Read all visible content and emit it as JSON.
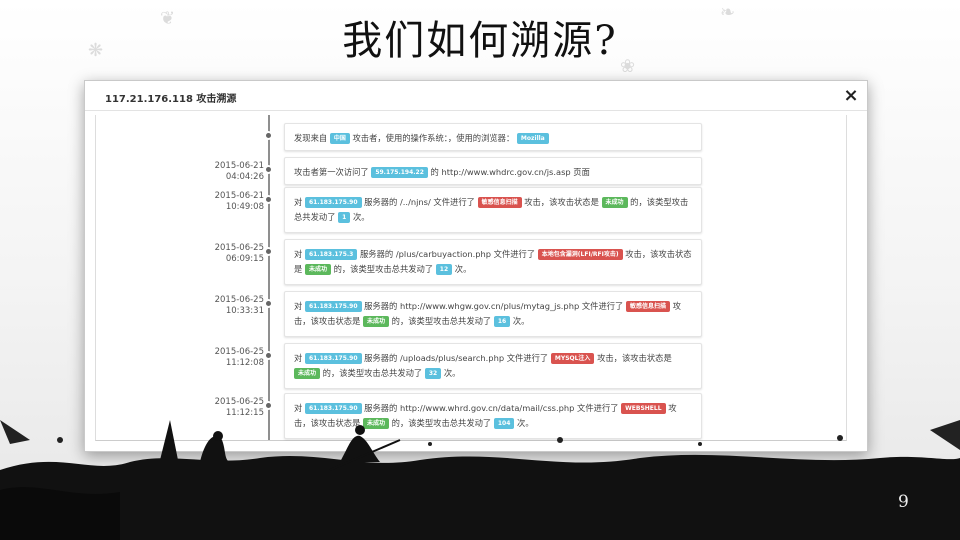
{
  "slide": {
    "title": "我们如何溯源?",
    "page_number": "9"
  },
  "modal": {
    "title": "117.21.176.118 攻击溯源",
    "close_label": "×"
  },
  "timeline": [
    {
      "time_date": "",
      "time_clock": "",
      "parts": [
        {
          "t": "text",
          "v": "发现来自 "
        },
        {
          "t": "badge",
          "c": "blue",
          "v": "中国"
        },
        {
          "t": "text",
          "v": " 攻击者，使用的操作系统：，使用的浏览器： "
        },
        {
          "t": "badge",
          "c": "blue",
          "v": "Mozilla"
        }
      ]
    },
    {
      "time_date": "2015-06-21",
      "time_clock": "04:04:26",
      "parts": [
        {
          "t": "text",
          "v": "攻击者第一次访问了 "
        },
        {
          "t": "badge",
          "c": "blue",
          "v": "59.175.194.22"
        },
        {
          "t": "text",
          "v": " 的 http://www.whdrc.gov.cn/js.asp 页面"
        }
      ]
    },
    {
      "time_date": "2015-06-21",
      "time_clock": "10:49:08",
      "parts": [
        {
          "t": "text",
          "v": "对 "
        },
        {
          "t": "badge",
          "c": "blue",
          "v": "61.183.175.90"
        },
        {
          "t": "text",
          "v": " 服务器的 /../njns/ 文件进行了 "
        },
        {
          "t": "badge",
          "c": "red",
          "v": "敏感信息扫描"
        },
        {
          "t": "text",
          "v": " 攻击，该攻击状态是 "
        },
        {
          "t": "badge",
          "c": "green",
          "v": "未成功"
        },
        {
          "t": "text",
          "v": " 的，该类型攻击总共发动了 "
        },
        {
          "t": "badge",
          "c": "blue",
          "v": "1"
        },
        {
          "t": "text",
          "v": " 次。"
        }
      ]
    },
    {
      "time_date": "2015-06-25",
      "time_clock": "06:09:15",
      "parts": [
        {
          "t": "text",
          "v": "对 "
        },
        {
          "t": "badge",
          "c": "blue",
          "v": "61.183.175.3"
        },
        {
          "t": "text",
          "v": " 服务器的 /plus/carbuyaction.php 文件进行了 "
        },
        {
          "t": "badge",
          "c": "red",
          "v": "本地包含漏洞(LFI/RFI攻击)"
        },
        {
          "t": "text",
          "v": " 攻击，该攻击状态是 "
        },
        {
          "t": "badge",
          "c": "green",
          "v": "未成功"
        },
        {
          "t": "text",
          "v": " 的，该类型攻击总共发动了 "
        },
        {
          "t": "badge",
          "c": "blue",
          "v": "12"
        },
        {
          "t": "text",
          "v": " 次。"
        }
      ]
    },
    {
      "time_date": "2015-06-25",
      "time_clock": "10:33:31",
      "parts": [
        {
          "t": "text",
          "v": "对 "
        },
        {
          "t": "badge",
          "c": "blue",
          "v": "61.183.175.90"
        },
        {
          "t": "text",
          "v": " 服务器的 http://www.whgw.gov.cn/plus/mytag_js.php 文件进行了 "
        },
        {
          "t": "badge",
          "c": "red",
          "v": "敏感信息扫描"
        },
        {
          "t": "text",
          "v": " 攻击，该攻击状态是 "
        },
        {
          "t": "badge",
          "c": "green",
          "v": "未成功"
        },
        {
          "t": "text",
          "v": " 的，该类型攻击总共发动了 "
        },
        {
          "t": "badge",
          "c": "blue",
          "v": "16"
        },
        {
          "t": "text",
          "v": " 次。"
        }
      ]
    },
    {
      "time_date": "2015-06-25",
      "time_clock": "11:12:08",
      "parts": [
        {
          "t": "text",
          "v": "对 "
        },
        {
          "t": "badge",
          "c": "blue",
          "v": "61.183.175.90"
        },
        {
          "t": "text",
          "v": " 服务器的 /uploads/plus/search.php 文件进行了 "
        },
        {
          "t": "badge",
          "c": "red",
          "v": "MYSQL注入"
        },
        {
          "t": "text",
          "v": " 攻击，该攻击状态是 "
        },
        {
          "t": "badge",
          "c": "green",
          "v": "未成功"
        },
        {
          "t": "text",
          "v": " 的，该类型攻击总共发动了 "
        },
        {
          "t": "badge",
          "c": "blue",
          "v": "32"
        },
        {
          "t": "text",
          "v": " 次。"
        }
      ]
    },
    {
      "time_date": "2015-06-25",
      "time_clock": "11:12:15",
      "parts": [
        {
          "t": "text",
          "v": "对 "
        },
        {
          "t": "badge",
          "c": "blue",
          "v": "61.183.175.90"
        },
        {
          "t": "text",
          "v": " 服务器的 http://www.whrd.gov.cn/data/mail/css.php 文件进行了 "
        },
        {
          "t": "badge",
          "c": "red",
          "v": "WEBSHELL"
        },
        {
          "t": "text",
          "v": " 攻击，该攻击状态是 "
        },
        {
          "t": "badge",
          "c": "green",
          "v": "未成功"
        },
        {
          "t": "text",
          "v": " 的，该类型攻击总共发动了 "
        },
        {
          "t": "badge",
          "c": "blue",
          "v": "104"
        },
        {
          "t": "text",
          "v": " 次。"
        }
      ]
    }
  ],
  "colors": {
    "badge_blue": "#5bc0de",
    "badge_red": "#d9534f",
    "badge_green": "#5cb85c"
  }
}
